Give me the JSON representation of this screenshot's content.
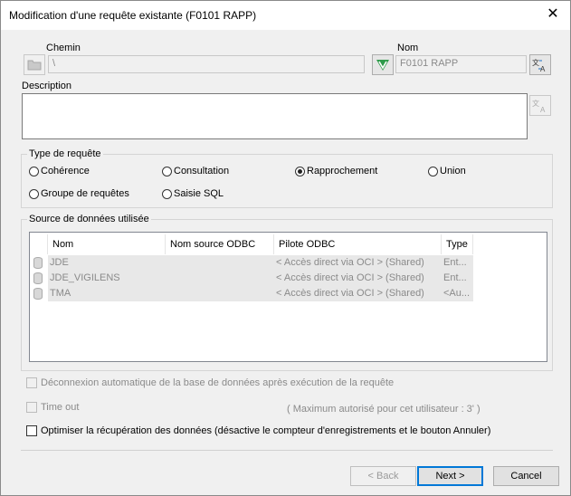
{
  "window": {
    "title": "Modification d'une requête existante (F0101 RAPP)",
    "close_glyph": "✕"
  },
  "chemin": {
    "label": "Chemin",
    "value": "\\"
  },
  "nom": {
    "label": "Nom",
    "value": "F0101 RAPP"
  },
  "description": {
    "label": "Description",
    "value": ""
  },
  "type_requete": {
    "title": "Type de requête",
    "options": [
      "Cohérence",
      "Consultation",
      "Rapprochement",
      "Union",
      "Groupe de requêtes",
      "Saisie SQL"
    ],
    "selected": "Rapprochement"
  },
  "source": {
    "title": "Source de données utilisée",
    "columns": [
      "Nom",
      "Nom source ODBC",
      "Pilote ODBC",
      "Type"
    ],
    "rows": [
      {
        "nom": "JDE",
        "odbc": "",
        "pilote": "< Accès direct via OCI > (Shared)",
        "type": "Ent..."
      },
      {
        "nom": "JDE_VIGILENS",
        "odbc": "",
        "pilote": "< Accès direct via OCI > (Shared)",
        "type": "Ent..."
      },
      {
        "nom": "TMA",
        "odbc": "",
        "pilote": "< Accès direct via OCI > (Shared)",
        "type": "<Au..."
      }
    ]
  },
  "options": {
    "deconnexion": "Déconnexion automatique de la base de données après exécution de la requête",
    "timeout": "Time out",
    "timeout_max": "( Maximum autorisé pour cet utilisateur :   3' )",
    "optimiser": "Optimiser la récupération des données (désactive le compteur d'enregistrements et le bouton Annuler)"
  },
  "buttons": {
    "back": "< Back",
    "next": "Next >",
    "cancel": "Cancel"
  },
  "icons": {
    "folder": "folder-icon",
    "v_logo": "v-logo-icon",
    "translate": "translate-icon"
  }
}
